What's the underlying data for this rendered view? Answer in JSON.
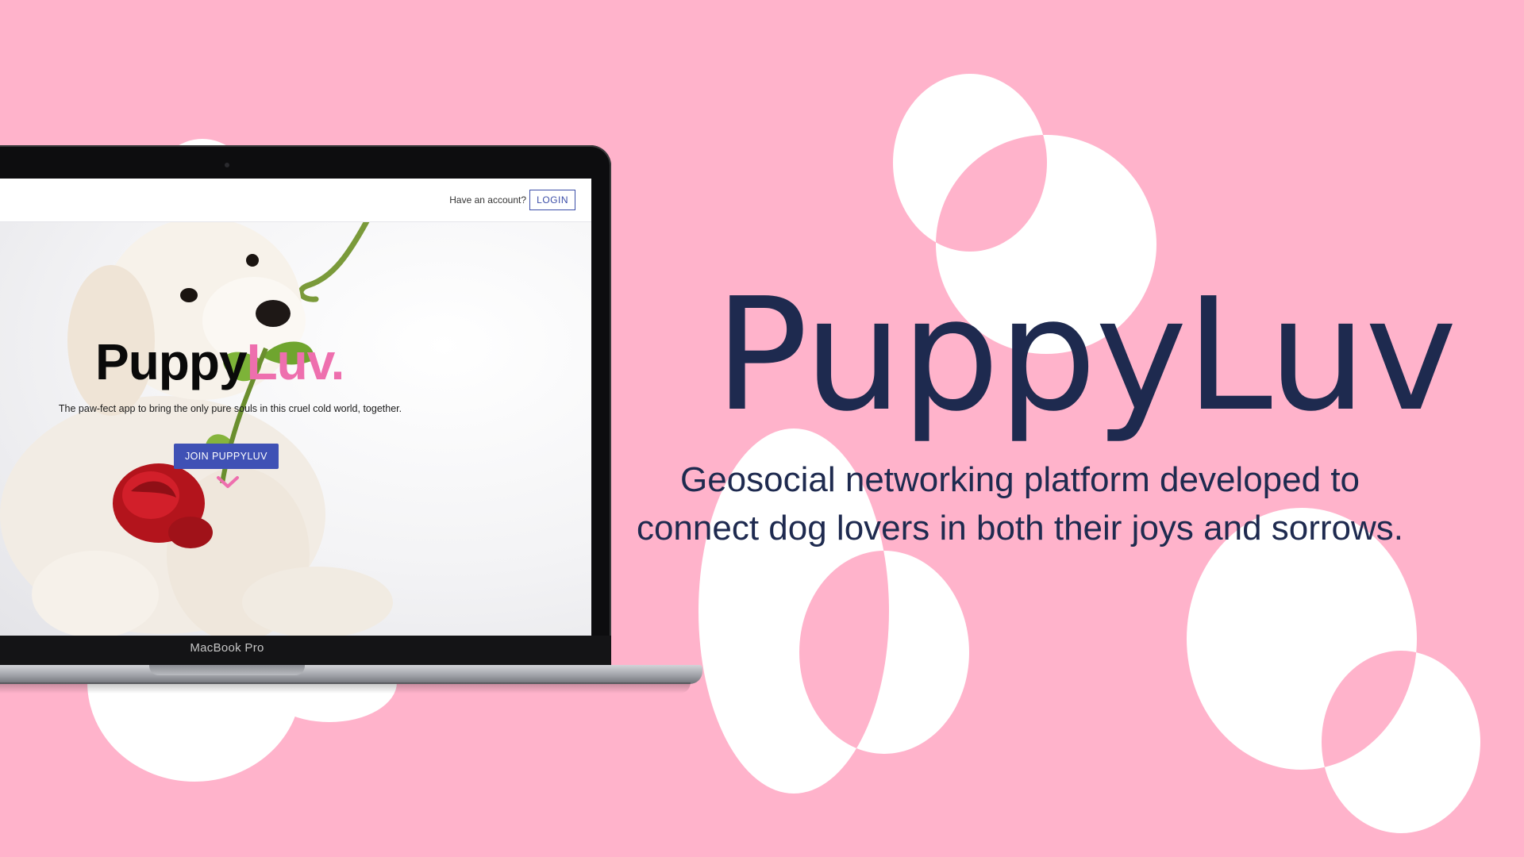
{
  "screen": {
    "header": {
      "have_account": "Have an account?",
      "login_label": "LOGIN"
    },
    "hero": {
      "brand_part1": "Puppy",
      "brand_part2": "Luv.",
      "tagline": "The paw-fect app to bring the only pure souls in this cruel cold world, together.",
      "join_label": "JOIN PUPPYLUV"
    }
  },
  "laptop_label": "MacBook Pro",
  "headline": {
    "title": "PuppyLuv",
    "description": "Geosocial networking platform developed to connect dog lovers in both their joys and sorrows."
  },
  "colors": {
    "background": "#ffb3cb",
    "shape": "#ffffff",
    "title": "#1e2a4f",
    "brand_pink": "#ee6fae",
    "button_blue": "#3f51b5"
  },
  "icons": [
    "chevron-down-icon"
  ]
}
